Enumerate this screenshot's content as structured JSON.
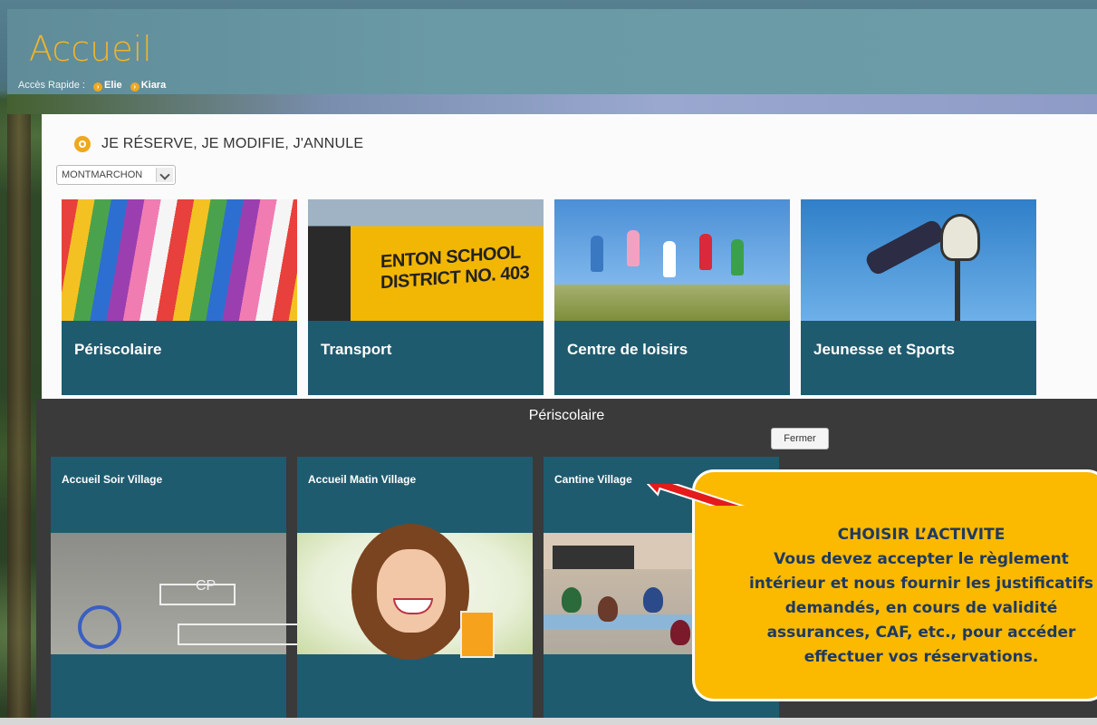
{
  "header": {
    "title": "Accueil",
    "quick_access_label": "Accès Rapide :",
    "children": [
      "Elie",
      "Kiara"
    ]
  },
  "section": {
    "title": "JE RÉSERVE, JE MODIFIE, J'ANNULE",
    "location_select": "MONTMARCHON"
  },
  "categories": [
    {
      "label": "Périscolaire"
    },
    {
      "label": "Transport",
      "image_text": "ENTON SCHOOL DISTRICT NO. 403"
    },
    {
      "label": "Centre de loisirs"
    },
    {
      "label": "Jeunesse et Sports"
    }
  ],
  "overlay": {
    "title": "Périscolaire",
    "close_label": "Fermer",
    "activities": [
      {
        "name": "Accueil Soir Village",
        "image_text": "CP"
      },
      {
        "name": "Accueil Matin Village"
      },
      {
        "name": "Cantine Village"
      }
    ]
  },
  "callout": {
    "heading": "CHOISIR L’ACTIVITE",
    "lines": [
      "Vous devez accepter le règlement",
      "intérieur et nous fournir les justificatifs",
      "demandés, en cours de validité",
      "assurances, CAF, etc., pour accéder",
      "effectuer vos réservations."
    ]
  },
  "colors": {
    "accent": "#f0a81c",
    "tile": "#1f5b6f",
    "overlay": "#3a3a3a",
    "callout": "#fbb900",
    "arrow": "#e31b1b"
  }
}
